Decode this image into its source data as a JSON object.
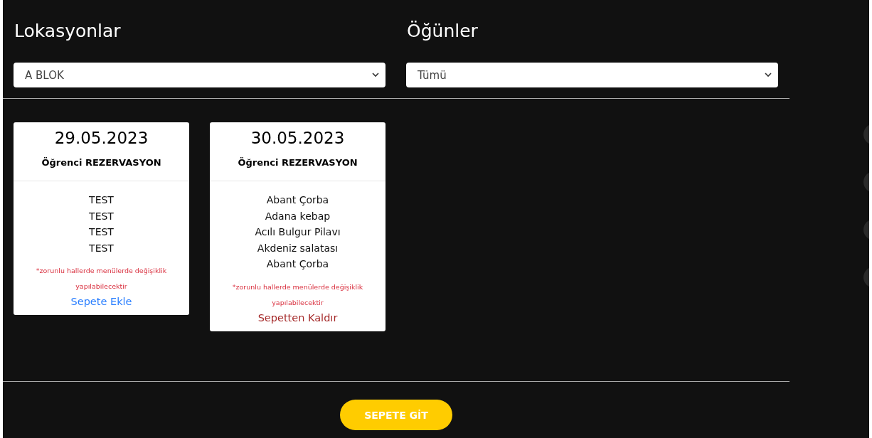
{
  "filters": [
    {
      "heading": "Lokasyonlar",
      "value": "A BLOK"
    },
    {
      "heading": "Öğünler",
      "value": "Tümü"
    }
  ],
  "cards": [
    {
      "date": "29.05.2023",
      "type": "Öğrenci REZERVASYON",
      "items": [
        "TEST",
        "TEST",
        "TEST",
        "TEST"
      ],
      "note": "*zorunlu hallerde menülerde değişiklik yapılabilecektir",
      "action": {
        "kind": "add",
        "label": "Sepete Ekle"
      }
    },
    {
      "date": "30.05.2023",
      "type": "Öğrenci REZERVASYON",
      "items": [
        "Abant Çorba",
        "Adana kebap",
        "Acılı Bulgur Pilavı",
        "Akdeniz salatası",
        "Abant Çorba"
      ],
      "note": "*zorunlu hallerde menülerde değişiklik yapılabilecektir",
      "action": {
        "kind": "remove",
        "label": "Sepetten Kaldır"
      }
    }
  ],
  "cart_button": "SEPETE GİT"
}
